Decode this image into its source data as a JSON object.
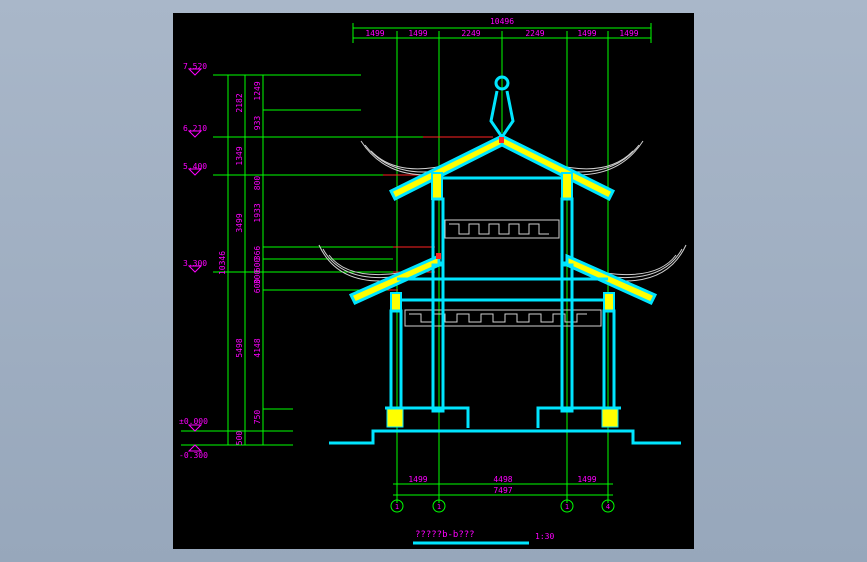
{
  "drawing": {
    "colors": {
      "background": "#000000",
      "structure": "#00e5ff",
      "beam_fill": "#ffff00",
      "dimension": "#ff00ff",
      "gridline": "#00ff00",
      "level_line": "#ff2222",
      "ornament": "#cfcfcf"
    },
    "top_dims": {
      "total": "10496",
      "segments": [
        "1499",
        "1499",
        "2249",
        "2249",
        "1499",
        "1499"
      ]
    },
    "bottom_dims": {
      "segments": [
        "1499",
        "4498",
        "1499"
      ],
      "total": "7497"
    },
    "axis_labels": [
      "1",
      "1",
      "1",
      "4"
    ],
    "levels": [
      "7.520",
      "6.210",
      "5.400",
      "3.300",
      "±0.000",
      "-0.300"
    ],
    "left_dims": {
      "col1": [
        "2182",
        "1349",
        "3499",
        "5498",
        "500"
      ],
      "col1_total": "10346",
      "col2": [
        "1249",
        "933",
        "800",
        "1933",
        "366",
        "600",
        "300",
        "600",
        "4148",
        "750"
      ]
    },
    "title": "?????b-b???",
    "scale": "1:30"
  }
}
